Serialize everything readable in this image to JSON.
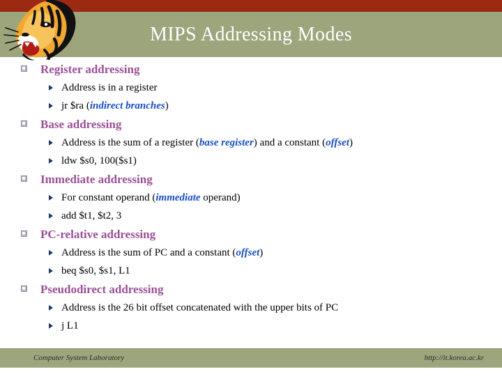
{
  "slide": {
    "title": "MIPS Addressing Modes",
    "colors": {
      "header_bar": "#9c2a13",
      "header_band": "#9ca57c",
      "title_text": "#ffffff",
      "heading_purple": "#9b4f96",
      "emphasis_blue": "#1a4fc4",
      "body_text": "#000000",
      "footer_band": "#9ca57c"
    },
    "logo": {
      "name": "tiger-head-mascot",
      "description": "Roaring tiger head facing left"
    },
    "sections": [
      {
        "heading": "Register addressing",
        "items": [
          {
            "parts": [
              {
                "text": "Address is in a register",
                "emphasis": false
              }
            ]
          },
          {
            "parts": [
              {
                "text": "jr $ra (",
                "emphasis": false
              },
              {
                "text": "indirect branches",
                "emphasis": true
              },
              {
                "text": ")",
                "emphasis": false
              }
            ]
          }
        ]
      },
      {
        "heading": "Base addressing",
        "items": [
          {
            "parts": [
              {
                "text": "Address is the sum of a register (",
                "emphasis": false
              },
              {
                "text": "base register",
                "emphasis": true
              },
              {
                "text": ") and a constant (",
                "emphasis": false
              },
              {
                "text": "offset",
                "emphasis": true
              },
              {
                "text": ")",
                "emphasis": false
              }
            ]
          },
          {
            "parts": [
              {
                "text": "ldw $s0, 100($s1)",
                "emphasis": false
              }
            ]
          }
        ]
      },
      {
        "heading": "Immediate addressing",
        "items": [
          {
            "parts": [
              {
                "text": "For constant operand (",
                "emphasis": false
              },
              {
                "text": "immediate",
                "emphasis": true
              },
              {
                "text": " operand)",
                "emphasis": false
              }
            ]
          },
          {
            "parts": [
              {
                "text": "add $t1, $t2, 3",
                "emphasis": false
              }
            ]
          }
        ]
      },
      {
        "heading": "PC-relative addressing",
        "items": [
          {
            "parts": [
              {
                "text": "Address is the sum of PC and a constant (",
                "emphasis": false
              },
              {
                "text": "offset",
                "emphasis": true
              },
              {
                "text": ")",
                "emphasis": false
              }
            ]
          },
          {
            "parts": [
              {
                "text": "beq $s0, $s1, L1",
                "emphasis": false
              }
            ]
          }
        ]
      },
      {
        "heading": "Pseudodirect addressing",
        "items": [
          {
            "parts": [
              {
                "text": "Address is the 26 bit offset concatenated with the upper bits of PC",
                "emphasis": false
              }
            ]
          },
          {
            "parts": [
              {
                "text": "j L1",
                "emphasis": false
              }
            ]
          }
        ]
      }
    ],
    "footer": {
      "left": "Computer System Laboratory",
      "right": "http://it.korea.ac.kr"
    }
  }
}
